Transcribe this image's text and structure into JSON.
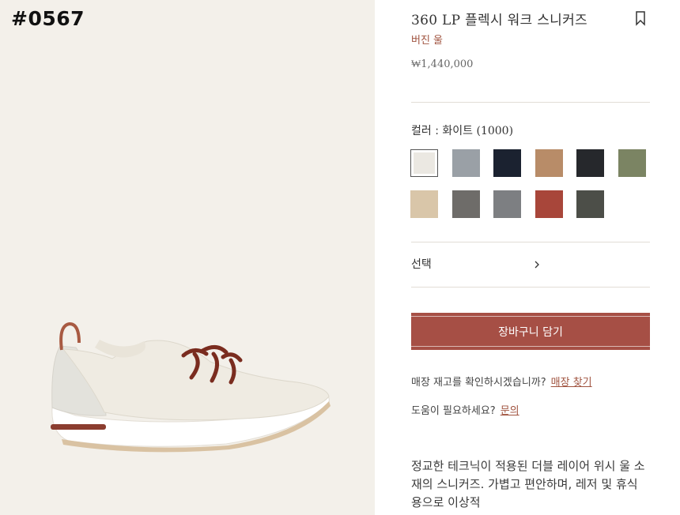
{
  "product_code": "#0567",
  "product": {
    "title": "360 LP 플렉시 워크 스니커즈",
    "subtitle": "버진 울",
    "price": "₩1,440,000"
  },
  "color": {
    "label": "컬러 : 화이트",
    "code": "(1000)",
    "swatches": [
      {
        "name": "white",
        "color": "#ebe8e2",
        "selected": true
      },
      {
        "name": "light-grey",
        "color": "#9aa0a6"
      },
      {
        "name": "navy",
        "color": "#1b2230"
      },
      {
        "name": "tan",
        "color": "#b88c68"
      },
      {
        "name": "black",
        "color": "#26282c"
      },
      {
        "name": "olive",
        "color": "#7b8463"
      },
      {
        "name": "beige",
        "color": "#d9c6a9"
      },
      {
        "name": "grey-melange",
        "color": "#6e6c69"
      },
      {
        "name": "mid-grey",
        "color": "#7d7f82"
      },
      {
        "name": "rust",
        "color": "#a8463a"
      },
      {
        "name": "charcoal",
        "color": "#4c4e48"
      }
    ]
  },
  "select": {
    "label": "선택"
  },
  "cart_button": "장바구니 담기",
  "store": {
    "question": "매장 재고를 확인하시겠습니까?",
    "link": "매장 찾기"
  },
  "help": {
    "question": "도움이 필요하세요?",
    "link": "문의"
  },
  "description": "정교한 테크닉이 적용된 더블 레이어 위시 울 소재의 스니커즈. 가볍고 편안하며, 레저 및 휴식용으로 이상적",
  "colors": {
    "accent": "#a64f45",
    "link": "#a0533f",
    "panel_bg": "#f3f0ea"
  }
}
